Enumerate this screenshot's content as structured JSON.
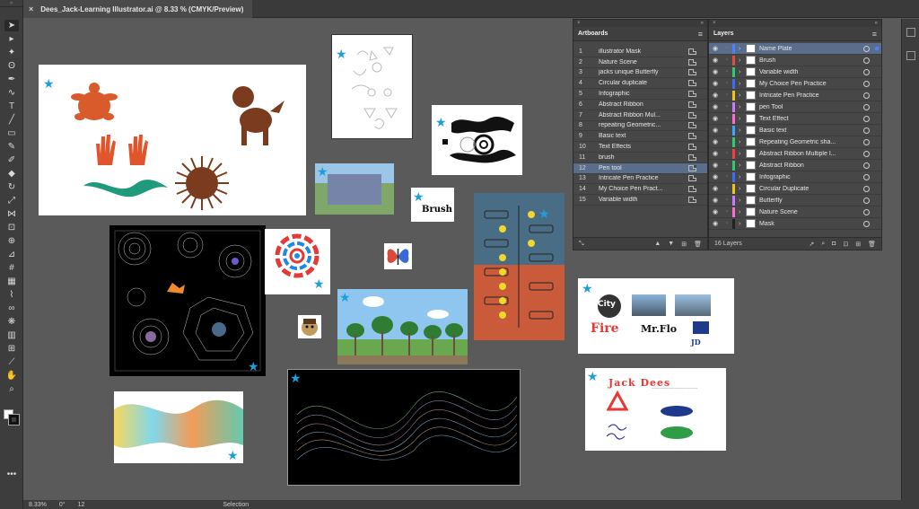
{
  "document": {
    "close_glyph": "×",
    "tab_title": "Dees_Jack-Learning Illustrator.ai @ 8.33 % (CMYK/Preview)"
  },
  "toolbar": {
    "tools": [
      "selection-tool-icon",
      "direct-selection-tool-icon",
      "magic-wand-icon",
      "lasso-icon",
      "pen-tool-icon",
      "curvature-tool-icon",
      "type-tool-icon",
      "line-segment-icon",
      "rectangle-tool-icon",
      "paintbrush-icon",
      "shaper-tool-icon",
      "eraser-icon",
      "rotate-tool-icon",
      "scale-tool-icon",
      "width-tool-icon",
      "free-transform-icon",
      "shape-builder-icon",
      "perspective-grid-icon",
      "mesh-tool-icon",
      "gradient-tool-icon",
      "eyedropper-icon",
      "blend-tool-icon",
      "symbol-sprayer-icon",
      "column-graph-icon",
      "artboard-tool-icon",
      "slice-tool-icon",
      "hand-tool-icon",
      "zoom-tool-icon"
    ],
    "more_glyph": "•••"
  },
  "status": {
    "zoom": "8.33%",
    "rotation": "0°",
    "artboard_nav": "12",
    "tool_readout": "Selection"
  },
  "artboards_panel": {
    "title": "Artboards",
    "menu_glyph": "≡",
    "collapse_glyph": "«",
    "close_glyph": "×",
    "selected_index": 11,
    "items": [
      {
        "num": "1",
        "name": "illustrator Mask"
      },
      {
        "num": "2",
        "name": "Nature Scene"
      },
      {
        "num": "3",
        "name": "jacks unique Butterfly"
      },
      {
        "num": "4",
        "name": "Circular duplicate"
      },
      {
        "num": "5",
        "name": "Infographic"
      },
      {
        "num": "6",
        "name": "Abstract Ribbon"
      },
      {
        "num": "7",
        "name": "Abstract Ribbon Mul..."
      },
      {
        "num": "8",
        "name": "repeating Geometric..."
      },
      {
        "num": "9",
        "name": "Basic text"
      },
      {
        "num": "10",
        "name": "Text Effects"
      },
      {
        "num": "11",
        "name": "brush"
      },
      {
        "num": "12",
        "name": "Pen tool"
      },
      {
        "num": "13",
        "name": "Intricate Pen Practice"
      },
      {
        "num": "14",
        "name": "My Choice Pen Pract..."
      },
      {
        "num": "15",
        "name": "Variable width"
      }
    ]
  },
  "layers_panel": {
    "title": "Layers",
    "menu_glyph": "≡",
    "collapse_glyph": "«",
    "close_glyph": "×",
    "count_label": "16 Layers",
    "selected_index": 0,
    "items": [
      {
        "name": "Name Plate",
        "color": "#4f7fff"
      },
      {
        "name": "Brush",
        "color": "#e74c3c"
      },
      {
        "name": "Variable width",
        "color": "#2ecc71"
      },
      {
        "name": "My Choice Pen Practice",
        "color": "#3b6cff"
      },
      {
        "name": "Intricate Pen Practice",
        "color": "#f1c40f"
      },
      {
        "name": "pen Tool",
        "color": "#c879ff"
      },
      {
        "name": "Text Effect",
        "color": "#ff6ad5"
      },
      {
        "name": "Basic text",
        "color": "#3aa7ff"
      },
      {
        "name": "Repeating Geometric sha...",
        "color": "#2ecc71"
      },
      {
        "name": "Abstract Ribbon Multiple I...",
        "color": "#ff3b3b"
      },
      {
        "name": "Abstract Ribbon",
        "color": "#2ecc71"
      },
      {
        "name": "Infographic",
        "color": "#3b6cff"
      },
      {
        "name": "Circular Duplicate",
        "color": "#f1c40f"
      },
      {
        "name": "Butterfly",
        "color": "#c879ff"
      },
      {
        "name": "Nature Scene",
        "color": "#ff6ad5"
      },
      {
        "name": "Mask",
        "color": "#222222"
      }
    ]
  },
  "artwork_text": {
    "brush": "Brush",
    "city": "City",
    "fire": "Fire",
    "mrflo": "Mr.Flo",
    "jd": "JD",
    "jack_dees": "Jack Dees"
  },
  "colors": {
    "accent_star": "#1e9fd8",
    "selection": "#5a6d8a",
    "turtle": "#d95a2b",
    "dog": "#7a3b1e",
    "teal": "#1f9a7a"
  }
}
